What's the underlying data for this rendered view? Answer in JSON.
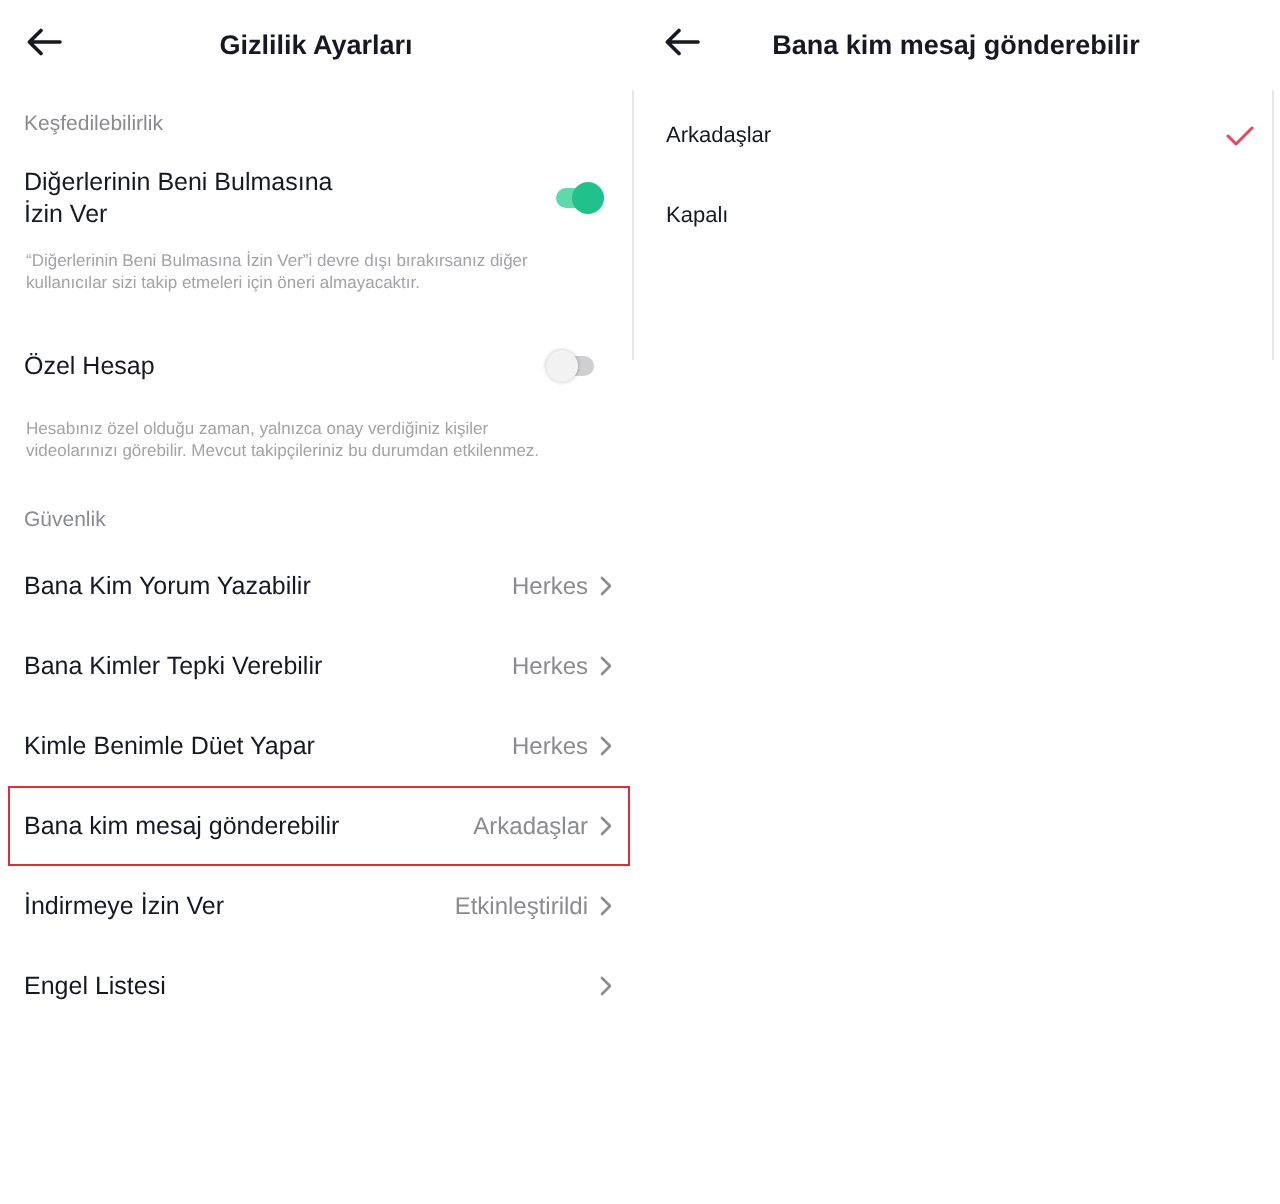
{
  "left_screen": {
    "title": "Gizlilik Ayarları",
    "sections": [
      {
        "heading": "Keşfedilebilirlik",
        "items": [
          {
            "kind": "toggle",
            "label": "Diğerlerinin Beni Bulmasına İzin Ver",
            "on": true,
            "description": "“Diğerlerinin Beni Bulmasına İzin Ver”i devre dışı bırakırsanız diğer kullanıcılar sizi takip etmeleri için öneri almayacaktır."
          },
          {
            "kind": "toggle",
            "label": "Özel Hesap",
            "on": false,
            "description": "Hesabınız özel olduğu zaman, yalnızca onay verdiğiniz kişiler videolarınızı görebilir. Mevcut takipçileriniz bu durumdan etkilenmez."
          }
        ]
      },
      {
        "heading": "Güvenlik",
        "items": [
          {
            "kind": "link",
            "label": "Bana Kim Yorum Yazabilir",
            "value": "Herkes",
            "highlighted": false
          },
          {
            "kind": "link",
            "label": "Bana Kimler Tepki Verebilir",
            "value": "Herkes",
            "highlighted": false
          },
          {
            "kind": "link",
            "label": "Kimle Benimle Düet Yapar",
            "value": "Herkes",
            "highlighted": false
          },
          {
            "kind": "link",
            "label": "Bana kim mesaj gönderebilir",
            "value": "Arkadaşlar",
            "highlighted": true
          },
          {
            "kind": "link",
            "label": "İndirmeye İzin Ver",
            "value": "Etkinleştirildi",
            "highlighted": false
          },
          {
            "kind": "link",
            "label": "Engel Listesi",
            "highlighted": false
          }
        ]
      }
    ]
  },
  "right_screen": {
    "title": "Bana kim mesaj gönderebilir",
    "options": [
      {
        "label": "Arkadaşlar",
        "selected": true
      },
      {
        "label": "Kapalı",
        "selected": false
      }
    ]
  }
}
